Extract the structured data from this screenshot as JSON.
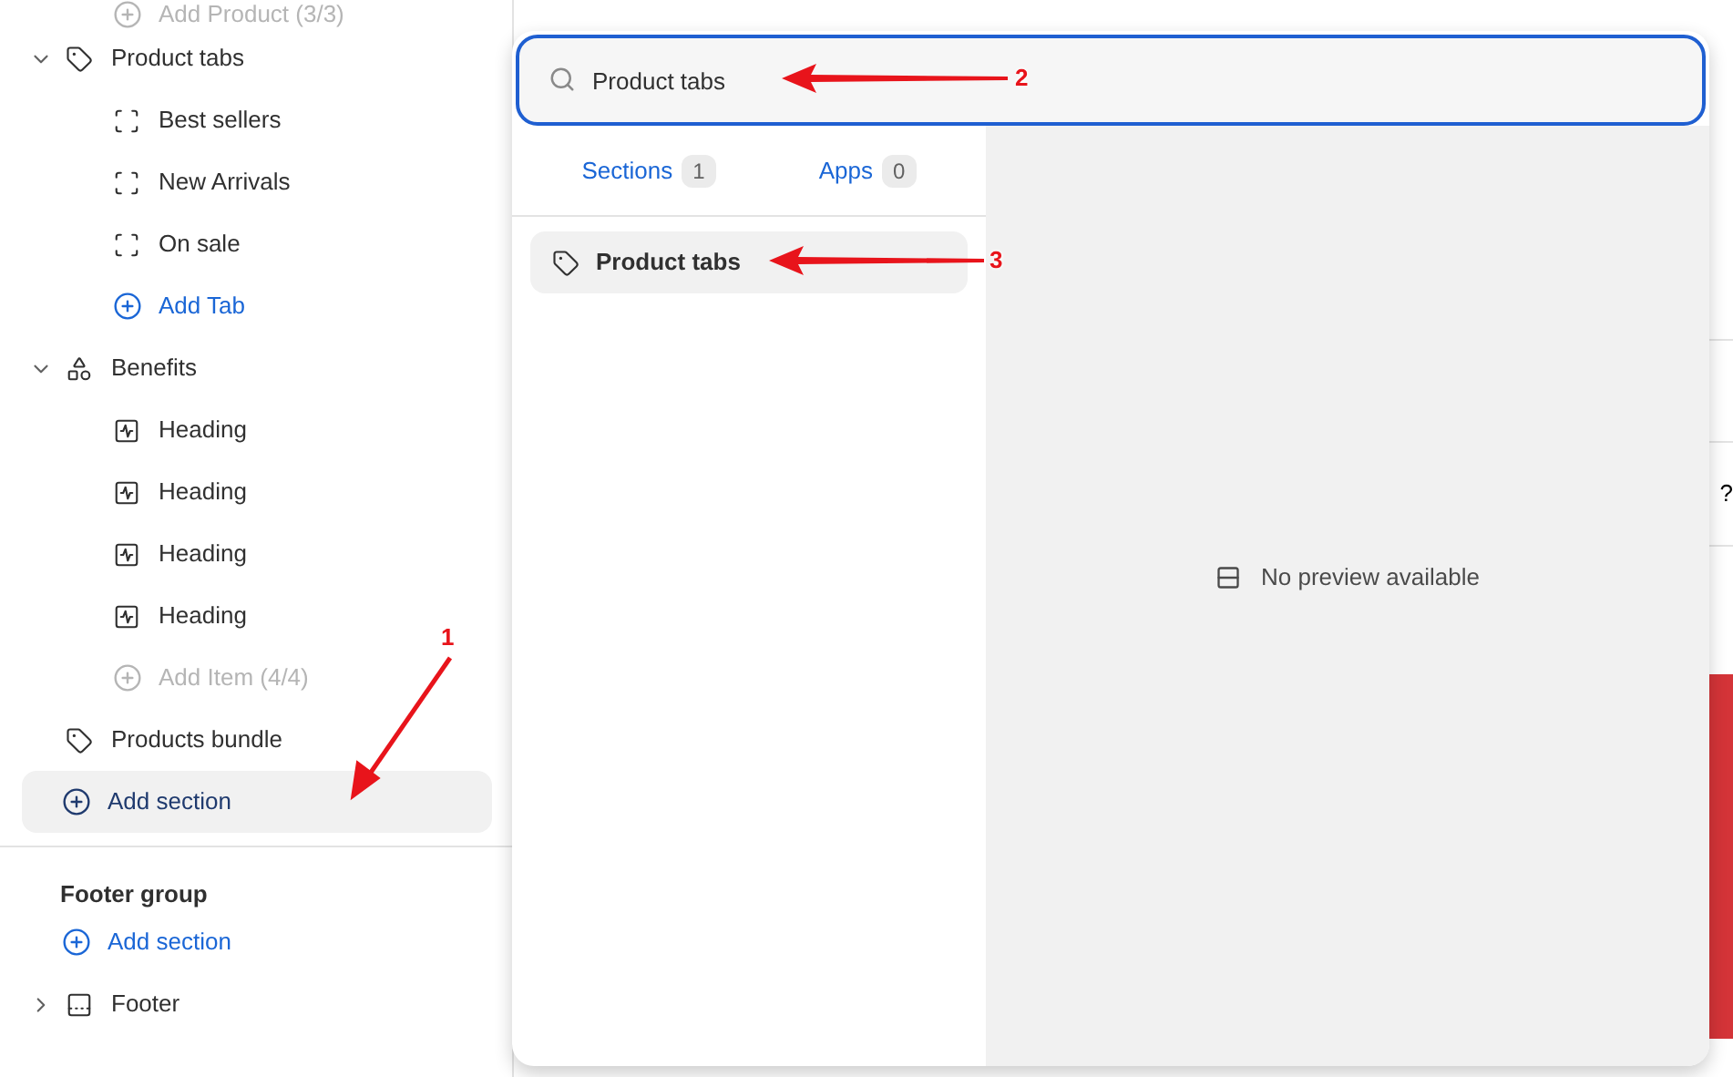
{
  "sidebar": {
    "items": [
      {
        "kind": "tail",
        "children": [
          {
            "kind": "add",
            "label": "Add Product (3/3)",
            "disabled": true,
            "highlighted": false
          }
        ]
      },
      {
        "kind": "section",
        "label": "Product tabs",
        "expanded": true,
        "children": [
          {
            "kind": "block",
            "label": "Best sellers"
          },
          {
            "kind": "block",
            "label": "New Arrivals"
          },
          {
            "kind": "block",
            "label": "On sale"
          },
          {
            "kind": "add",
            "label": "Add Tab",
            "disabled": false,
            "highlighted": false
          }
        ]
      },
      {
        "kind": "section",
        "label": "Benefits",
        "expanded": true,
        "children": [
          {
            "kind": "block",
            "label": "Heading"
          },
          {
            "kind": "block",
            "label": "Heading"
          },
          {
            "kind": "block",
            "label": "Heading"
          },
          {
            "kind": "block",
            "label": "Heading"
          },
          {
            "kind": "add",
            "label": "Add Item (4/4)",
            "disabled": true,
            "highlighted": false
          }
        ]
      },
      {
        "kind": "section",
        "label": "Products bundle"
      },
      {
        "kind": "add",
        "label": "Add section",
        "disabled": false,
        "highlighted": true
      }
    ],
    "footer_group": {
      "title": "Footer group",
      "items": [
        {
          "kind": "add",
          "label": "Add section",
          "disabled": false,
          "highlighted": false
        },
        {
          "kind": "section",
          "label": "Footer",
          "expanded": false
        }
      ]
    }
  },
  "background_page": {
    "fragment": "?"
  },
  "picker": {
    "search": {
      "value": "Product tabs"
    },
    "tabs": [
      {
        "label": "Sections",
        "count": "1"
      },
      {
        "label": "Apps",
        "count": "0"
      }
    ],
    "results": [
      {
        "label": "Product tabs",
        "highlighted": true
      }
    ],
    "preview": {
      "message": "No preview available"
    }
  },
  "annotations": [
    {
      "number": "1"
    },
    {
      "number": "2"
    },
    {
      "number": "3"
    }
  ]
}
